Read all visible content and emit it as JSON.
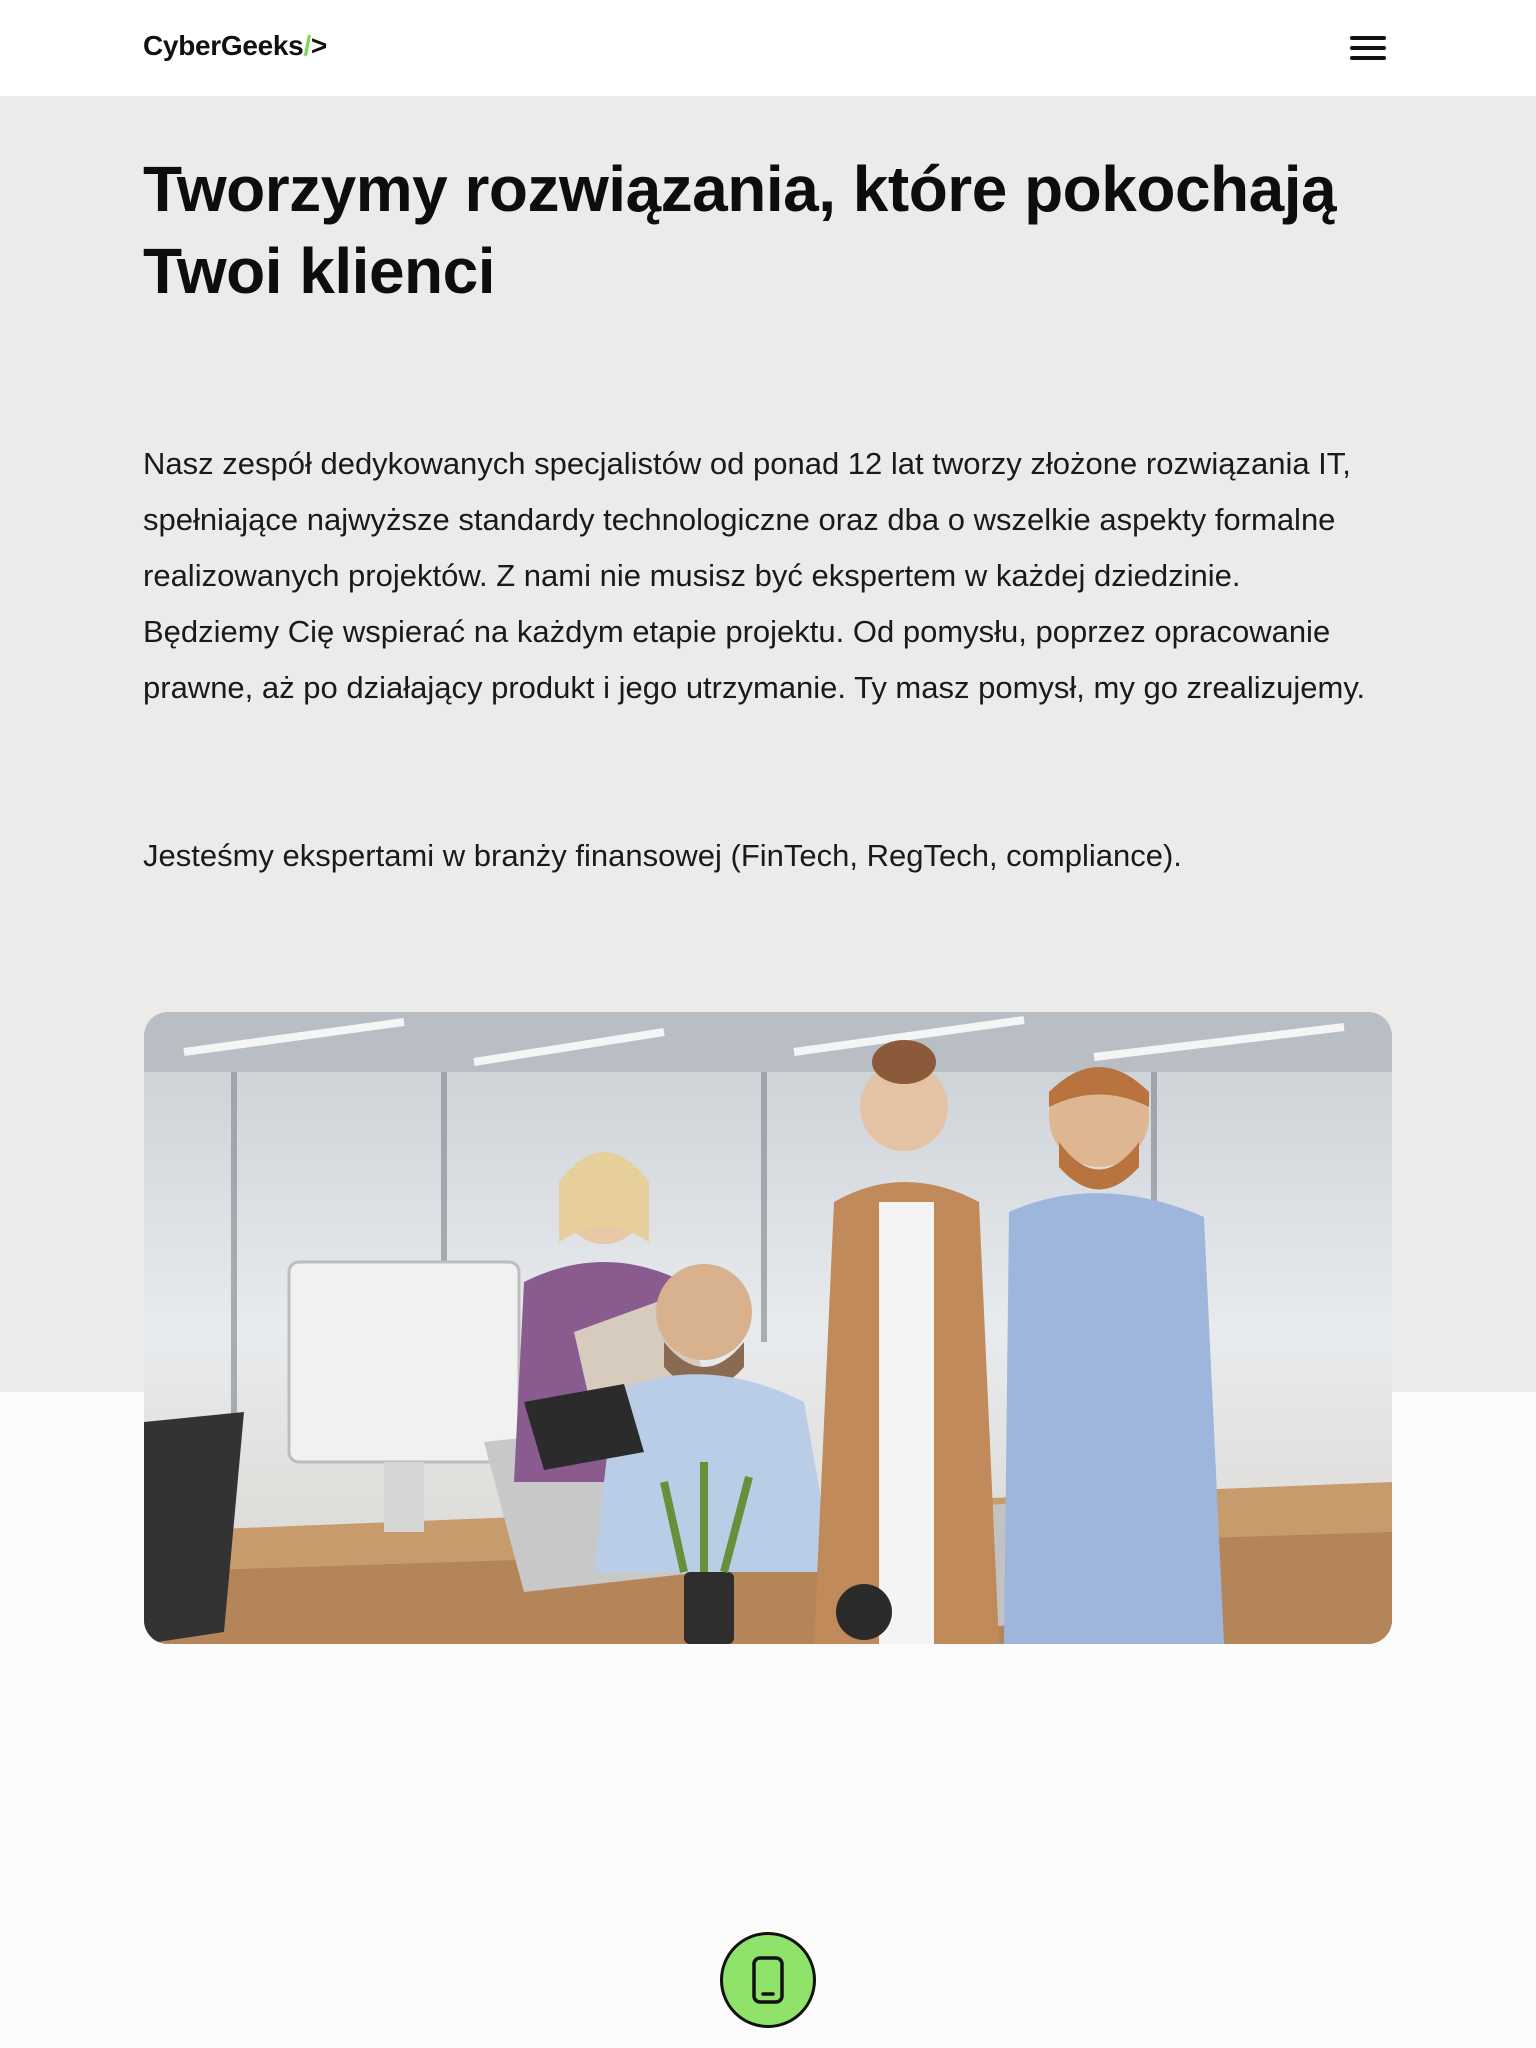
{
  "header": {
    "logo_text": "CyberGeeks",
    "logo_slash": "/",
    "logo_suffix": ">",
    "menu_icon": "hamburger-icon"
  },
  "hero": {
    "title": "Tworzymy rozwiązania, które pokochają Twoi klienci",
    "paragraph": "Nasz zespół dedykowanych specjalistów od ponad 12 lat tworzy złożone rozwiązania IT, spełniające najwyższe standardy technologiczne oraz dba o wszelkie aspekty formalne realizowanych projektów. Z nami nie musisz być ekspertem w każdej dziedzinie. Będziemy Cię wspierać na każdym etapie projektu. Od pomysłu, poprzez opracowanie prawne, aż po działający produkt i jego utrzymanie. Ty masz pomysł, my go zrealizujemy.",
    "paragraph2": "Jesteśmy ekspertami w branży finansowej (FinTech, RegTech, compliance)."
  },
  "phone_button": {
    "icon": "phone-icon"
  },
  "colors": {
    "accent": "#8fe36b",
    "hero_bg": "#ecebea",
    "text": "#111111"
  }
}
